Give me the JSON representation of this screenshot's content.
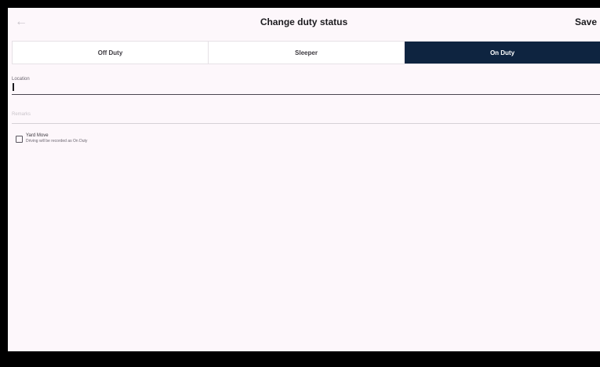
{
  "header": {
    "back_icon": "arrow-left-icon",
    "title": "Change duty status",
    "save_label": "Save"
  },
  "segments": [
    {
      "label": "Off Duty",
      "active": false
    },
    {
      "label": "Sleeper",
      "active": false
    },
    {
      "label": "On Duty",
      "active": true
    }
  ],
  "location": {
    "label": "Location",
    "value": ""
  },
  "remarks": {
    "placeholder": "Remarks",
    "value": ""
  },
  "yard_move": {
    "label": "Yard Move",
    "description": "Driving will be recorded as On Duty",
    "checked": false
  },
  "colors": {
    "active_segment": "#0e2440",
    "background": "#fdf7fb",
    "bottom_bar": "#000000"
  }
}
